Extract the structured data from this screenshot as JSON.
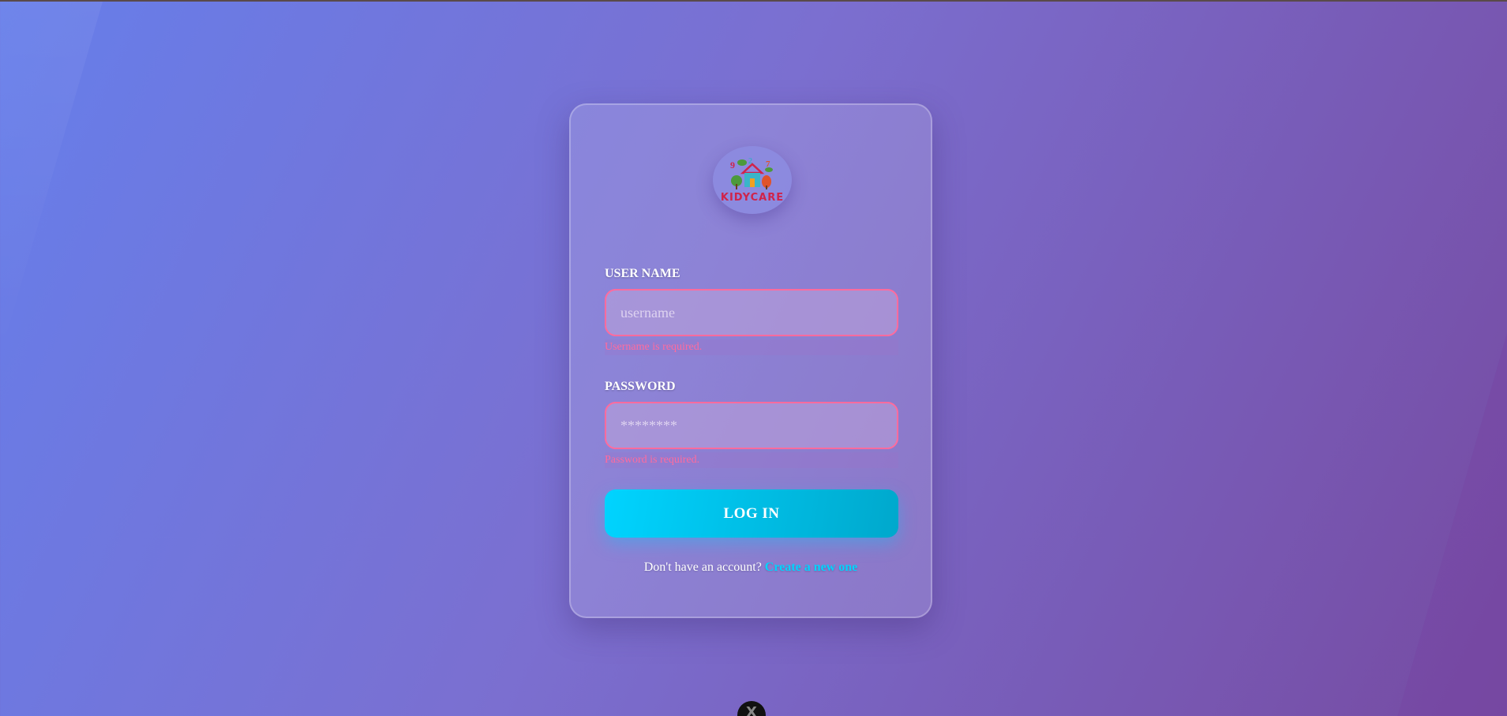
{
  "logo": {
    "text": "KIDYCARE"
  },
  "form": {
    "username": {
      "label": "USER NAME",
      "placeholder": "username",
      "error": "Username is required."
    },
    "password": {
      "label": "PASSWORD",
      "placeholder": "********",
      "error": "Password is required."
    },
    "submit_label": "LOG IN",
    "signup_prompt": "Don't have an account?",
    "signup_link": "Create a new one"
  },
  "overlay": {
    "close_label": "X"
  },
  "colors": {
    "accent": "#00d4ff",
    "error": "#ff6b9d",
    "brand": "#d0234a"
  }
}
